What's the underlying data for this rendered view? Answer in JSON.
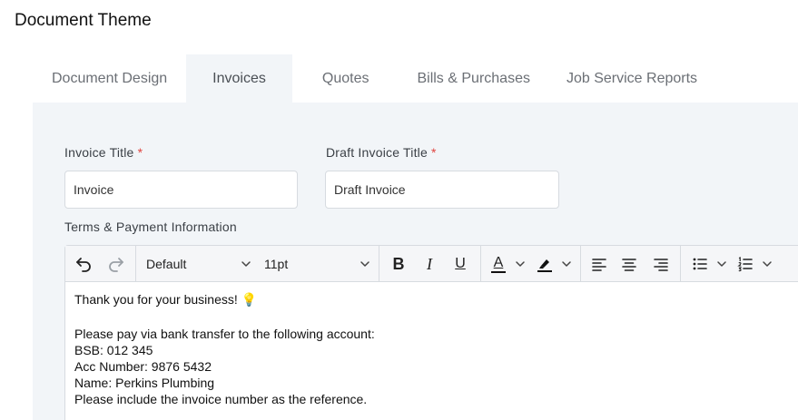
{
  "page": {
    "title": "Document Theme"
  },
  "tabs": [
    {
      "label": "Document Design",
      "active": false
    },
    {
      "label": "Invoices",
      "active": true
    },
    {
      "label": "Quotes",
      "active": false
    },
    {
      "label": "Bills & Purchases",
      "active": false
    },
    {
      "label": "Job Service Reports",
      "active": false
    }
  ],
  "form": {
    "invoice_title": {
      "label": "Invoice Title",
      "required_mark": "*",
      "value": "Invoice"
    },
    "draft_invoice_title": {
      "label": "Draft Invoice Title",
      "required_mark": "*",
      "value": "Draft Invoice"
    },
    "terms": {
      "label": "Terms & Payment Information"
    }
  },
  "editor": {
    "toolbar": {
      "undo_icon": "undo-icon",
      "redo_icon": "redo-icon",
      "font_family": "Default",
      "font_size": "11pt",
      "bold": "B",
      "italic": "I",
      "underline": "U",
      "font_color": "A",
      "colors": {
        "highlight": "#111111",
        "asterisk": "#e0443f",
        "panel": "#f2f5f8"
      }
    },
    "content": {
      "line1": "Thank you for your business! 💡",
      "line2": "Please pay via bank transfer to the following account:",
      "line3": "BSB: 012 345",
      "line4": "Acc Number: 9876 5432",
      "line5": "Name: Perkins Plumbing",
      "line6": "Please include the invoice number as the reference."
    }
  }
}
